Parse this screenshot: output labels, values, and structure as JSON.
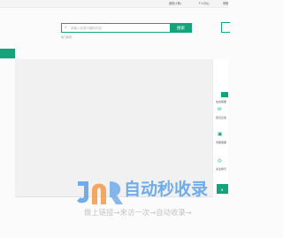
{
  "topbar": {
    "link1": "我的(1条)",
    "link2": "个人中心",
    "link3": "帮助"
  },
  "search": {
    "placeholder": "请输入你感兴趣的内容",
    "button_label": "搜索",
    "hot_label": "热门搜索："
  },
  "rail": {
    "item_a": "在线客服",
    "item_b": "意见反馈",
    "item_c": "专属客服",
    "item_d": "关注我们"
  },
  "watermark": {
    "brand": "自动秒收录",
    "tagline": "做上链接→来访一次→自动收录→"
  },
  "colors": {
    "accent": "#14a37a",
    "brand_blue": "#5aa0e6"
  }
}
